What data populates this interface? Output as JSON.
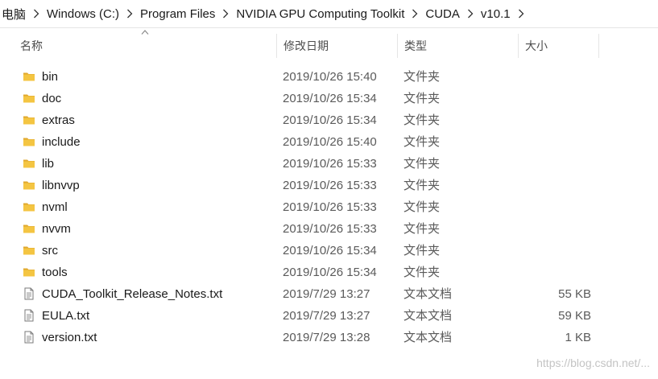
{
  "breadcrumb": {
    "items": [
      {
        "label": "电脑"
      },
      {
        "label": "Windows (C:)"
      },
      {
        "label": "Program Files"
      },
      {
        "label": "NVIDIA GPU Computing Toolkit"
      },
      {
        "label": "CUDA"
      },
      {
        "label": "v10.1"
      }
    ],
    "separator_icon": "chevron-right-icon"
  },
  "columns": {
    "name": "名称",
    "date": "修改日期",
    "type": "类型",
    "size": "大小",
    "sorted_by": "name",
    "sort_icon": "sort-ascending-icon"
  },
  "files": [
    {
      "name": "bin",
      "date": "2019/10/26 15:40",
      "type": "文件夹",
      "size": "",
      "icon": "folder-icon"
    },
    {
      "name": "doc",
      "date": "2019/10/26 15:34",
      "type": "文件夹",
      "size": "",
      "icon": "folder-icon"
    },
    {
      "name": "extras",
      "date": "2019/10/26 15:34",
      "type": "文件夹",
      "size": "",
      "icon": "folder-icon"
    },
    {
      "name": "include",
      "date": "2019/10/26 15:40",
      "type": "文件夹",
      "size": "",
      "icon": "folder-icon"
    },
    {
      "name": "lib",
      "date": "2019/10/26 15:33",
      "type": "文件夹",
      "size": "",
      "icon": "folder-icon"
    },
    {
      "name": "libnvvp",
      "date": "2019/10/26 15:33",
      "type": "文件夹",
      "size": "",
      "icon": "folder-icon"
    },
    {
      "name": "nvml",
      "date": "2019/10/26 15:33",
      "type": "文件夹",
      "size": "",
      "icon": "folder-icon"
    },
    {
      "name": "nvvm",
      "date": "2019/10/26 15:33",
      "type": "文件夹",
      "size": "",
      "icon": "folder-icon"
    },
    {
      "name": "src",
      "date": "2019/10/26 15:34",
      "type": "文件夹",
      "size": "",
      "icon": "folder-icon"
    },
    {
      "name": "tools",
      "date": "2019/10/26 15:34",
      "type": "文件夹",
      "size": "",
      "icon": "folder-icon"
    },
    {
      "name": "CUDA_Toolkit_Release_Notes.txt",
      "date": "2019/7/29 13:27",
      "type": "文本文档",
      "size": "55 KB",
      "icon": "text-file-icon"
    },
    {
      "name": "EULA.txt",
      "date": "2019/7/29 13:27",
      "type": "文本文档",
      "size": "59 KB",
      "icon": "text-file-icon"
    },
    {
      "name": "version.txt",
      "date": "2019/7/29 13:28",
      "type": "文本文档",
      "size": "1 KB",
      "icon": "text-file-icon"
    }
  ],
  "watermark": "https://blog.csdn.net/...",
  "colors": {
    "folder": "#f4c542",
    "folder_dark": "#e0a82e",
    "text_secondary": "#5a5a5a",
    "divider": "#e5e5e5"
  }
}
